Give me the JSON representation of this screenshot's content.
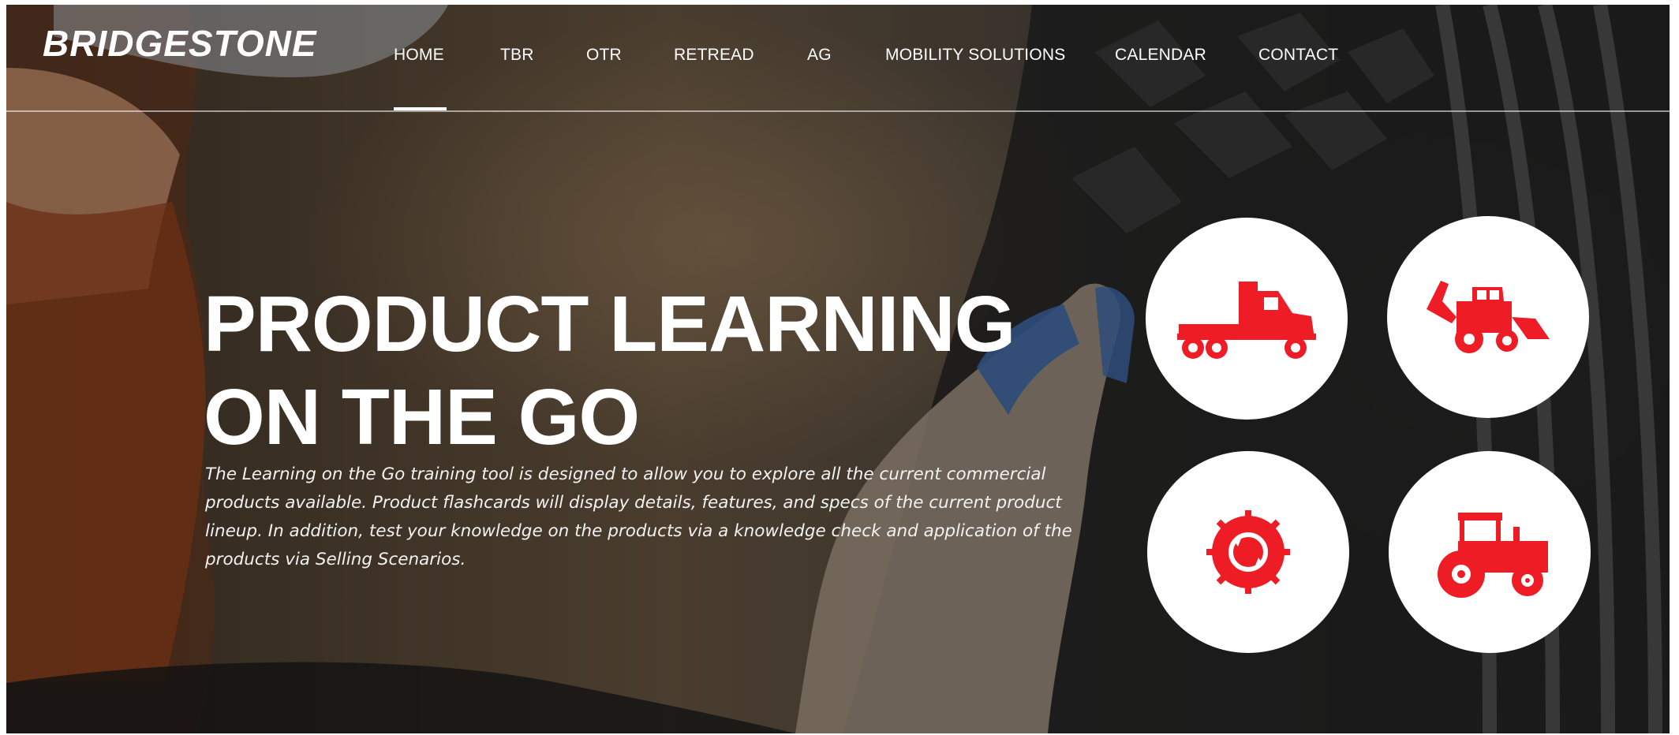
{
  "brand": {
    "logo_text": "BRIDGESTONE"
  },
  "nav": {
    "items": [
      {
        "label": "HOME",
        "active": true
      },
      {
        "label": "TBR"
      },
      {
        "label": "OTR"
      },
      {
        "label": "RETREAD"
      },
      {
        "label": "AG"
      },
      {
        "label": "MOBILITY SOLUTIONS"
      },
      {
        "label": "CALENDAR"
      },
      {
        "label": "CONTACT"
      }
    ]
  },
  "hero": {
    "title_line1": "PRODUCT LEARNING",
    "title_line2": "ON THE GO",
    "description": "The Learning on the Go training tool is designed to allow you to explore all the current commercial products available. Product flashcards will display details, features, and specs of the current product lineup. In addition, test your knowledge on the products via a knowledge check and application of the products via Selling Scenarios."
  },
  "categories": [
    {
      "icon": "semi-truck-icon"
    },
    {
      "icon": "backhoe-loader-icon"
    },
    {
      "icon": "retread-tire-icon"
    },
    {
      "icon": "tractor-icon"
    }
  ],
  "colors": {
    "accent": "#ee1c25",
    "text": "#ffffff"
  }
}
